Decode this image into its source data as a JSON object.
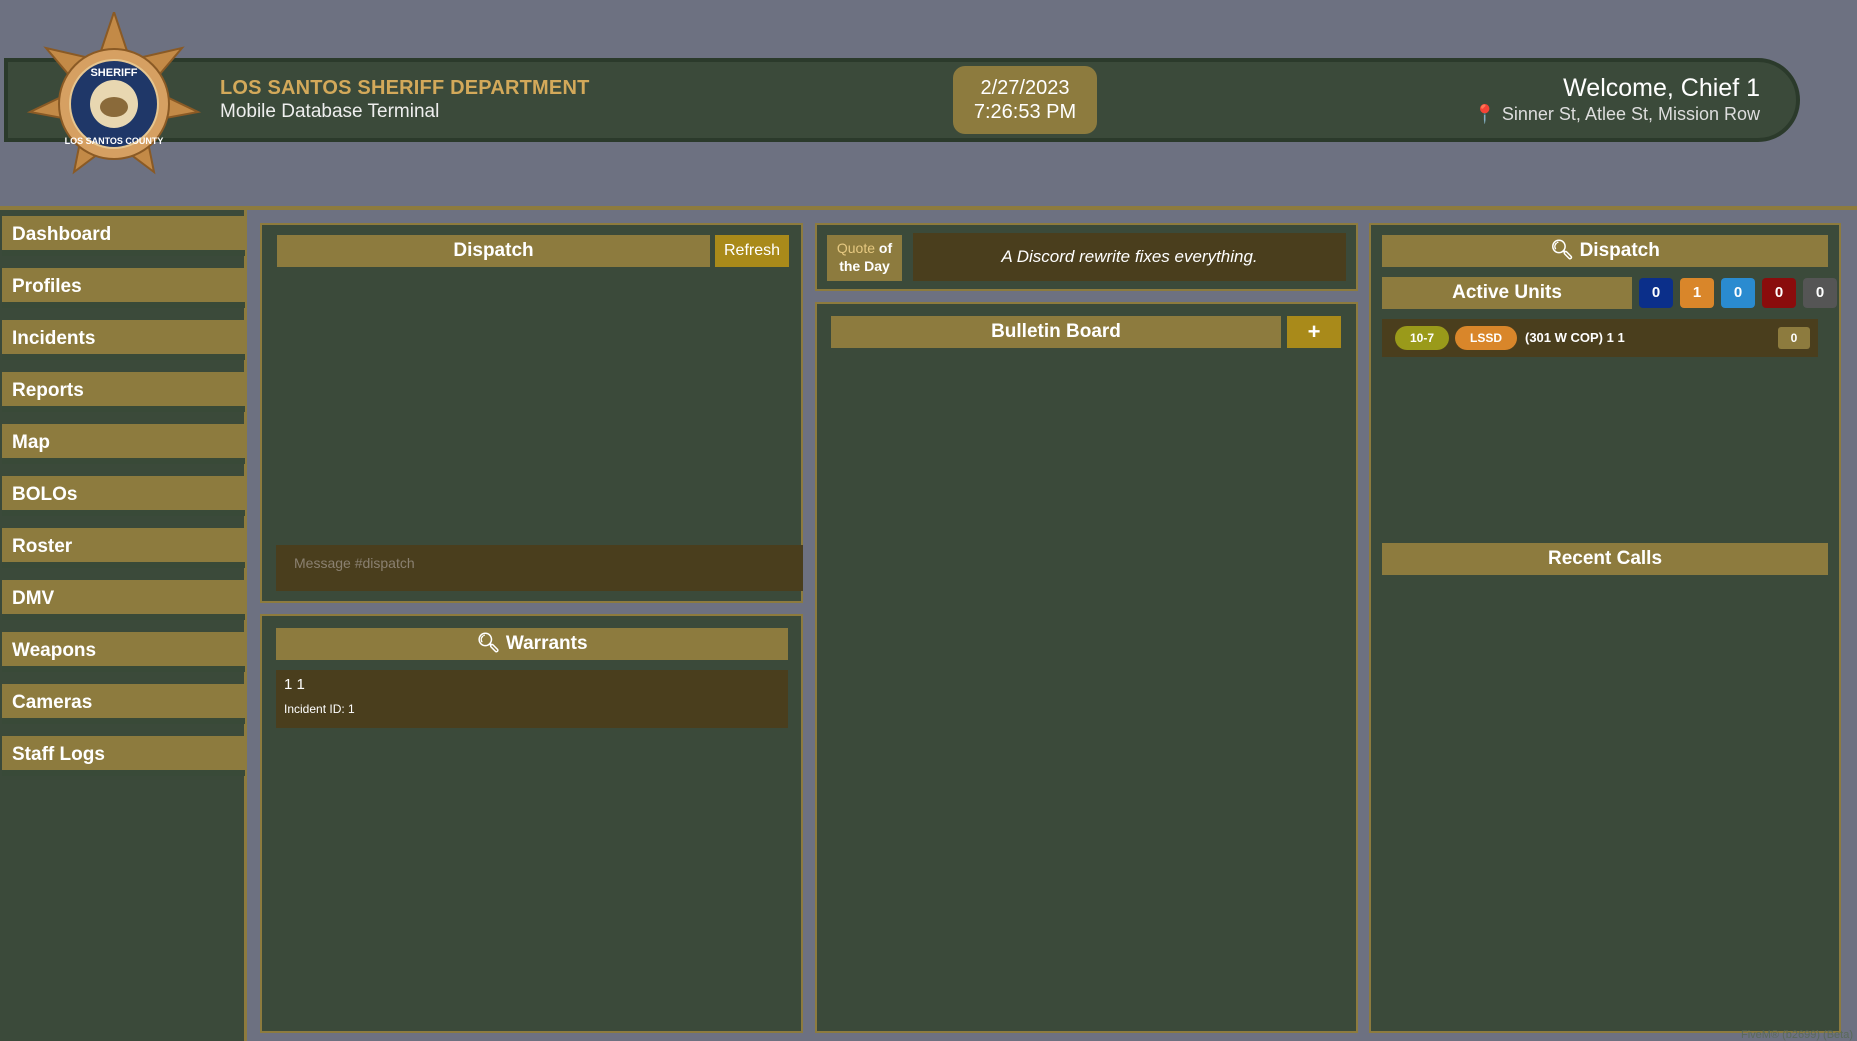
{
  "header": {
    "department": "LOS SANTOS SHERIFF DEPARTMENT",
    "subtitle": "Mobile Database Terminal",
    "date": "2/27/2023",
    "time": "7:26:53 PM",
    "welcome": "Welcome, Chief 1",
    "location": "Sinner St, Atlee St, Mission Row",
    "badge": {
      "top": "SHERIFF",
      "bottom": "LOS SANTOS COUNTY"
    }
  },
  "sidebar": {
    "items": [
      {
        "label": "Dashboard"
      },
      {
        "label": "Profiles"
      },
      {
        "label": "Incidents"
      },
      {
        "label": "Reports"
      },
      {
        "label": "Map"
      },
      {
        "label": "BOLOs"
      },
      {
        "label": "Roster"
      },
      {
        "label": "DMV"
      },
      {
        "label": "Weapons"
      },
      {
        "label": "Cameras"
      },
      {
        "label": "Staff Logs"
      }
    ]
  },
  "dispatch": {
    "title": "Dispatch",
    "refresh_label": "Refresh",
    "message_placeholder": "Message #dispatch"
  },
  "warrants": {
    "title": "Warrants",
    "items": [
      {
        "name": "1 1",
        "incident": "Incident ID: 1"
      }
    ]
  },
  "quote": {
    "label_a": "Quote",
    "label_b": "of",
    "label_c": "the Day",
    "text": "A Discord rewrite fixes everything."
  },
  "bulletin": {
    "title": "Bulletin Board",
    "add_label": "+"
  },
  "right_dispatch": {
    "title": "Dispatch",
    "active_units_label": "Active Units",
    "counts": [
      {
        "value": "0",
        "color": "#0b2f8a"
      },
      {
        "value": "1",
        "color": "#d9862a"
      },
      {
        "value": "0",
        "color": "#2a8bd0"
      },
      {
        "value": "0",
        "color": "#8a0c0c"
      },
      {
        "value": "0",
        "color": "#555555"
      }
    ],
    "units": [
      {
        "status": "10-7",
        "dept": "LSSD",
        "callsign": "(301 W COP) 1 1",
        "count": "0"
      }
    ],
    "recent_calls_title": "Recent Calls"
  },
  "footer": {
    "text": "FiveM® (b2699) (Beta)"
  },
  "colors": {
    "gold": "#8d7b3e",
    "panel": "#3b4a3a",
    "card": "#4a3e1d",
    "title_gold": "#d3a95a"
  }
}
